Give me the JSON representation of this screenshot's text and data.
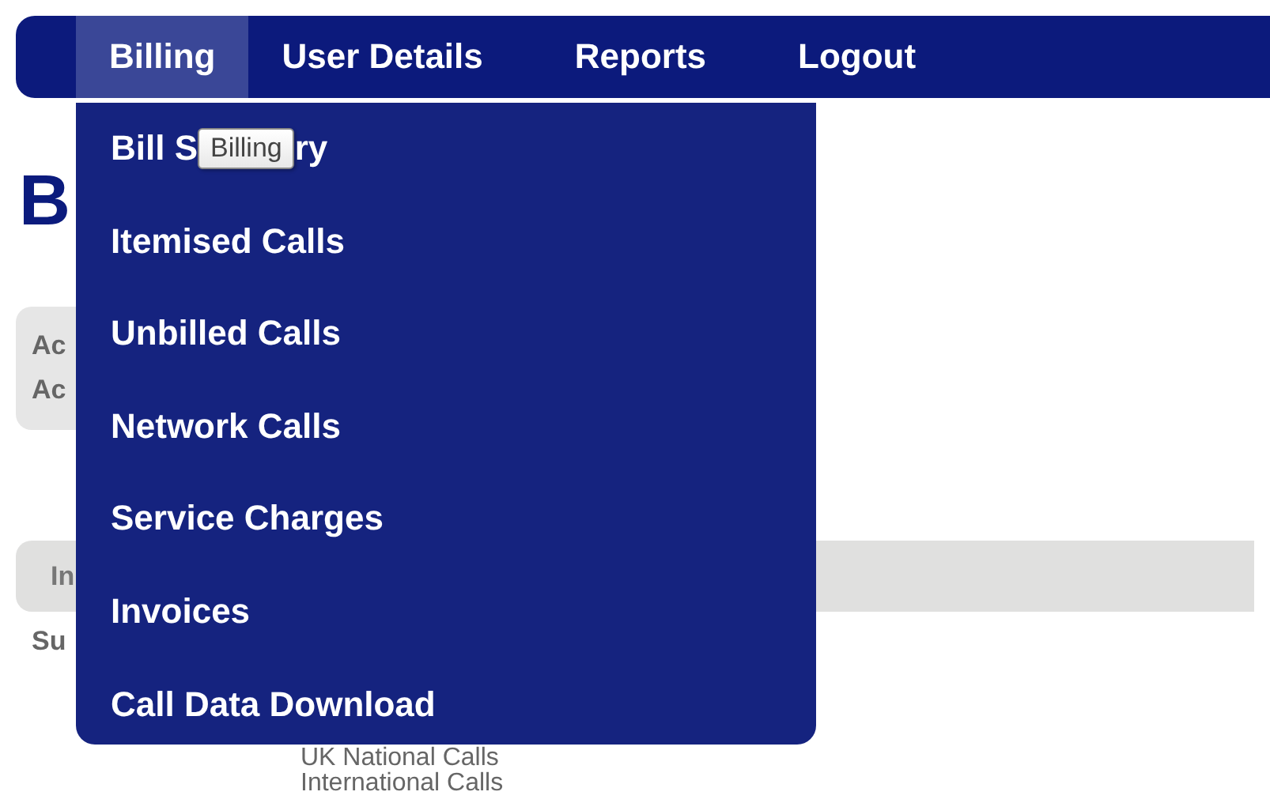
{
  "nav": {
    "tabs": [
      {
        "label": "Billing",
        "selected": true
      },
      {
        "label": "User Details",
        "selected": false
      },
      {
        "label": "Reports",
        "selected": false
      },
      {
        "label": "Logout",
        "selected": false
      }
    ]
  },
  "dropdown": {
    "first_item": {
      "label": "Bill S",
      "tail": "ry"
    },
    "items": [
      {
        "label": "Itemised Calls"
      },
      {
        "label": "Unbilled Calls"
      },
      {
        "label": "Network Calls"
      },
      {
        "label": "Service Charges"
      },
      {
        "label": "Invoices"
      },
      {
        "label": "Call Data Download"
      }
    ]
  },
  "tooltip": {
    "text": "Billing"
  },
  "page": {
    "heading": "B",
    "account": [
      "Ac",
      "Ac"
    ],
    "invoice_bar": "In",
    "summary_title": "Su",
    "call_types": [
      "UK National Calls",
      "International Calls"
    ]
  }
}
